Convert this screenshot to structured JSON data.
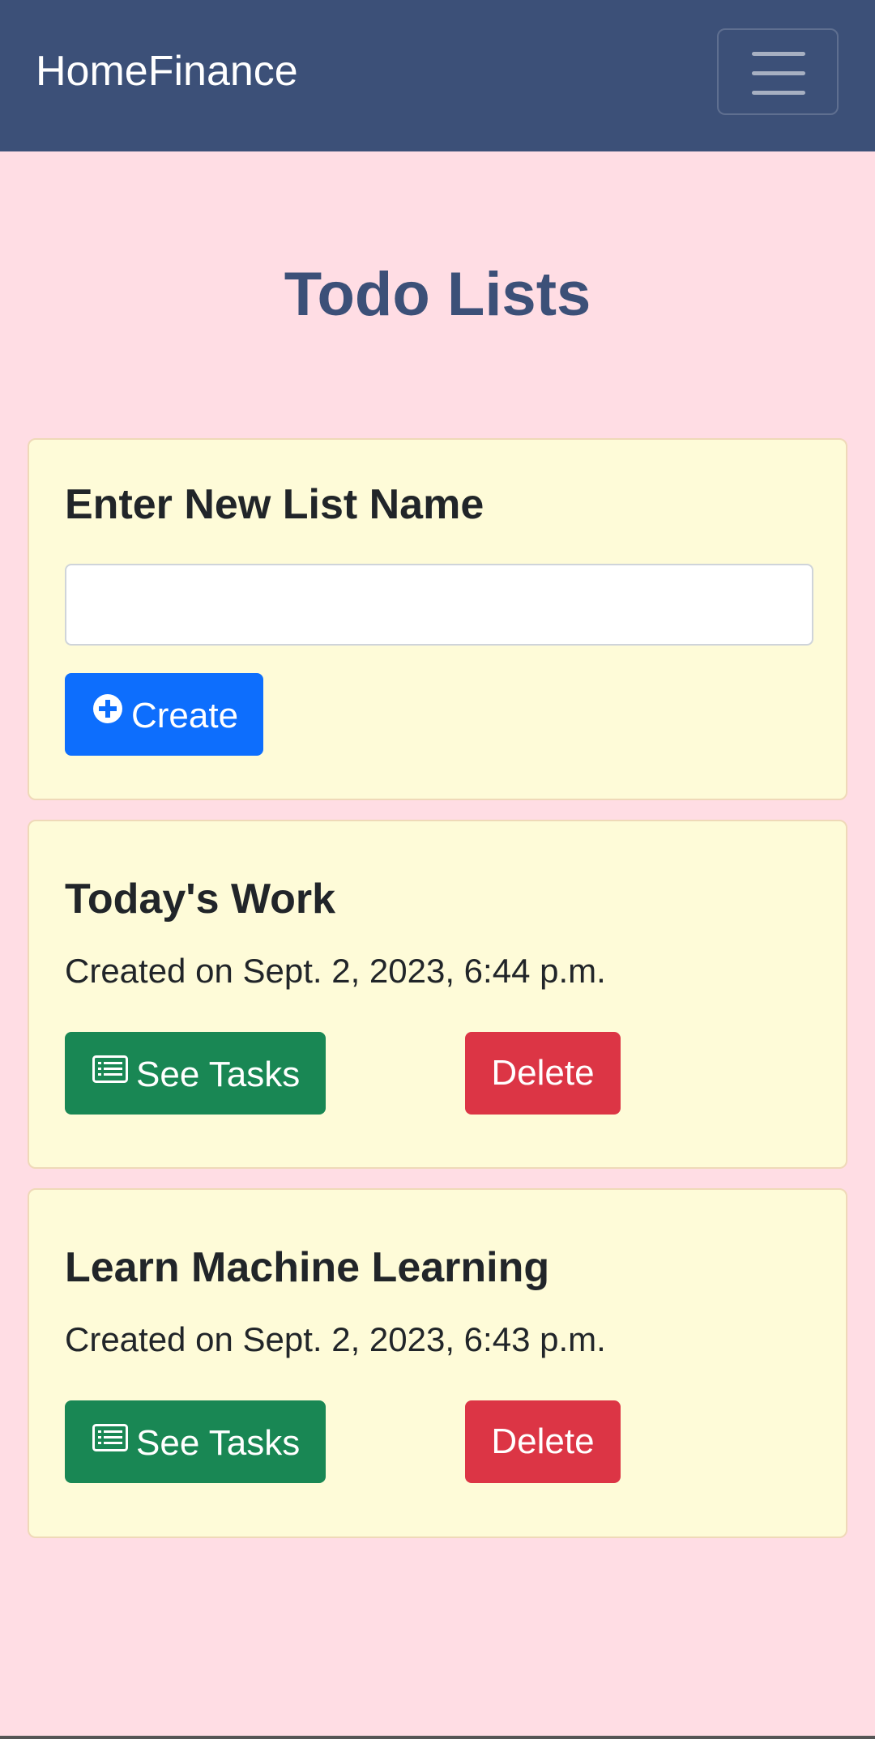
{
  "navbar": {
    "brand": "HomeFinance",
    "menu_icon": "hamburger-menu-icon"
  },
  "page": {
    "title": "Todo Lists"
  },
  "new_list": {
    "heading": "Enter New List Name",
    "input_value": "",
    "input_placeholder": "",
    "create_label": "Create",
    "create_icon": "plus-circle-icon"
  },
  "lists": [
    {
      "name": "Today's Work",
      "created": "Created on Sept. 2, 2023, 6:44 p.m.",
      "see_tasks_label": "See Tasks",
      "see_tasks_icon": "list-icon",
      "delete_label": "Delete"
    },
    {
      "name": "Learn Machine Learning",
      "created": "Created on Sept. 2, 2023, 6:43 p.m.",
      "see_tasks_label": "See Tasks",
      "see_tasks_icon": "list-icon",
      "delete_label": "Delete"
    }
  ],
  "colors": {
    "navbar_bg": "#3c5078",
    "page_bg": "#ffdde4",
    "card_bg": "#fefbd8",
    "primary": "#0d6efd",
    "success": "#198754",
    "danger": "#dc3545",
    "title": "#3c5078"
  }
}
